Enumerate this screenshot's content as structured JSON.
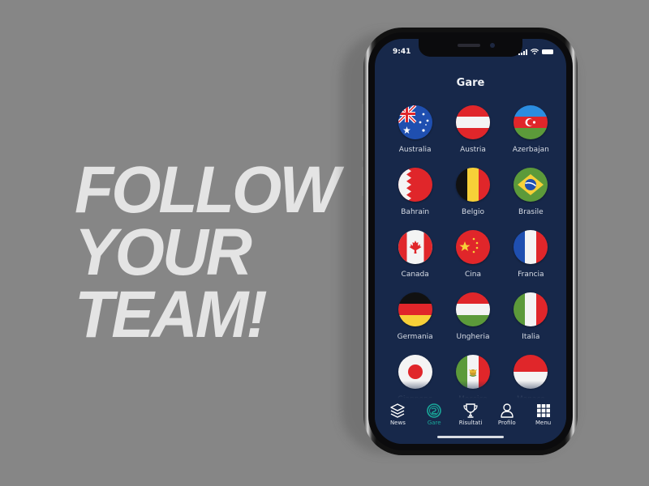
{
  "headline": {
    "lines": [
      "FOLLOW",
      "YOUR",
      "TEAM!"
    ]
  },
  "status_bar": {
    "time": "9:41",
    "icons": [
      "signal-icon",
      "wifi-icon",
      "battery-icon"
    ]
  },
  "screen": {
    "title": "Gare"
  },
  "races": [
    {
      "label": "Australia",
      "flag": "australia-flag-icon"
    },
    {
      "label": "Austria",
      "flag": "austria-flag-icon"
    },
    {
      "label": "Azerbajan",
      "flag": "azerbaijan-flag-icon"
    },
    {
      "label": "Bahrain",
      "flag": "bahrain-flag-icon"
    },
    {
      "label": "Belgio",
      "flag": "belgium-flag-icon"
    },
    {
      "label": "Brasile",
      "flag": "brazil-flag-icon"
    },
    {
      "label": "Canada",
      "flag": "canada-flag-icon"
    },
    {
      "label": "Cina",
      "flag": "china-flag-icon"
    },
    {
      "label": "Francia",
      "flag": "france-flag-icon"
    },
    {
      "label": "Germania",
      "flag": "germany-flag-icon"
    },
    {
      "label": "Ungheria",
      "flag": "hungary-flag-icon"
    },
    {
      "label": "Italia",
      "flag": "italy-flag-icon"
    },
    {
      "label": "Giappone",
      "flag": "japan-flag-icon"
    },
    {
      "label": "Messico",
      "flag": "mexico-flag-icon"
    },
    {
      "label": "Monaco",
      "flag": "monaco-flag-icon"
    }
  ],
  "tabbar": {
    "active": "Gare",
    "items": [
      {
        "label": "News",
        "icon": "layers-icon"
      },
      {
        "label": "Gare",
        "icon": "race-badge-icon"
      },
      {
        "label": "Risultati",
        "icon": "trophy-icon"
      },
      {
        "label": "Profilo",
        "icon": "user-icon"
      },
      {
        "label": "Menu",
        "icon": "grid-menu-icon"
      }
    ]
  },
  "colors": {
    "background": "#868686",
    "screen": "#17284a",
    "accent": "#19a89a",
    "headline": "#e4e4e4"
  }
}
